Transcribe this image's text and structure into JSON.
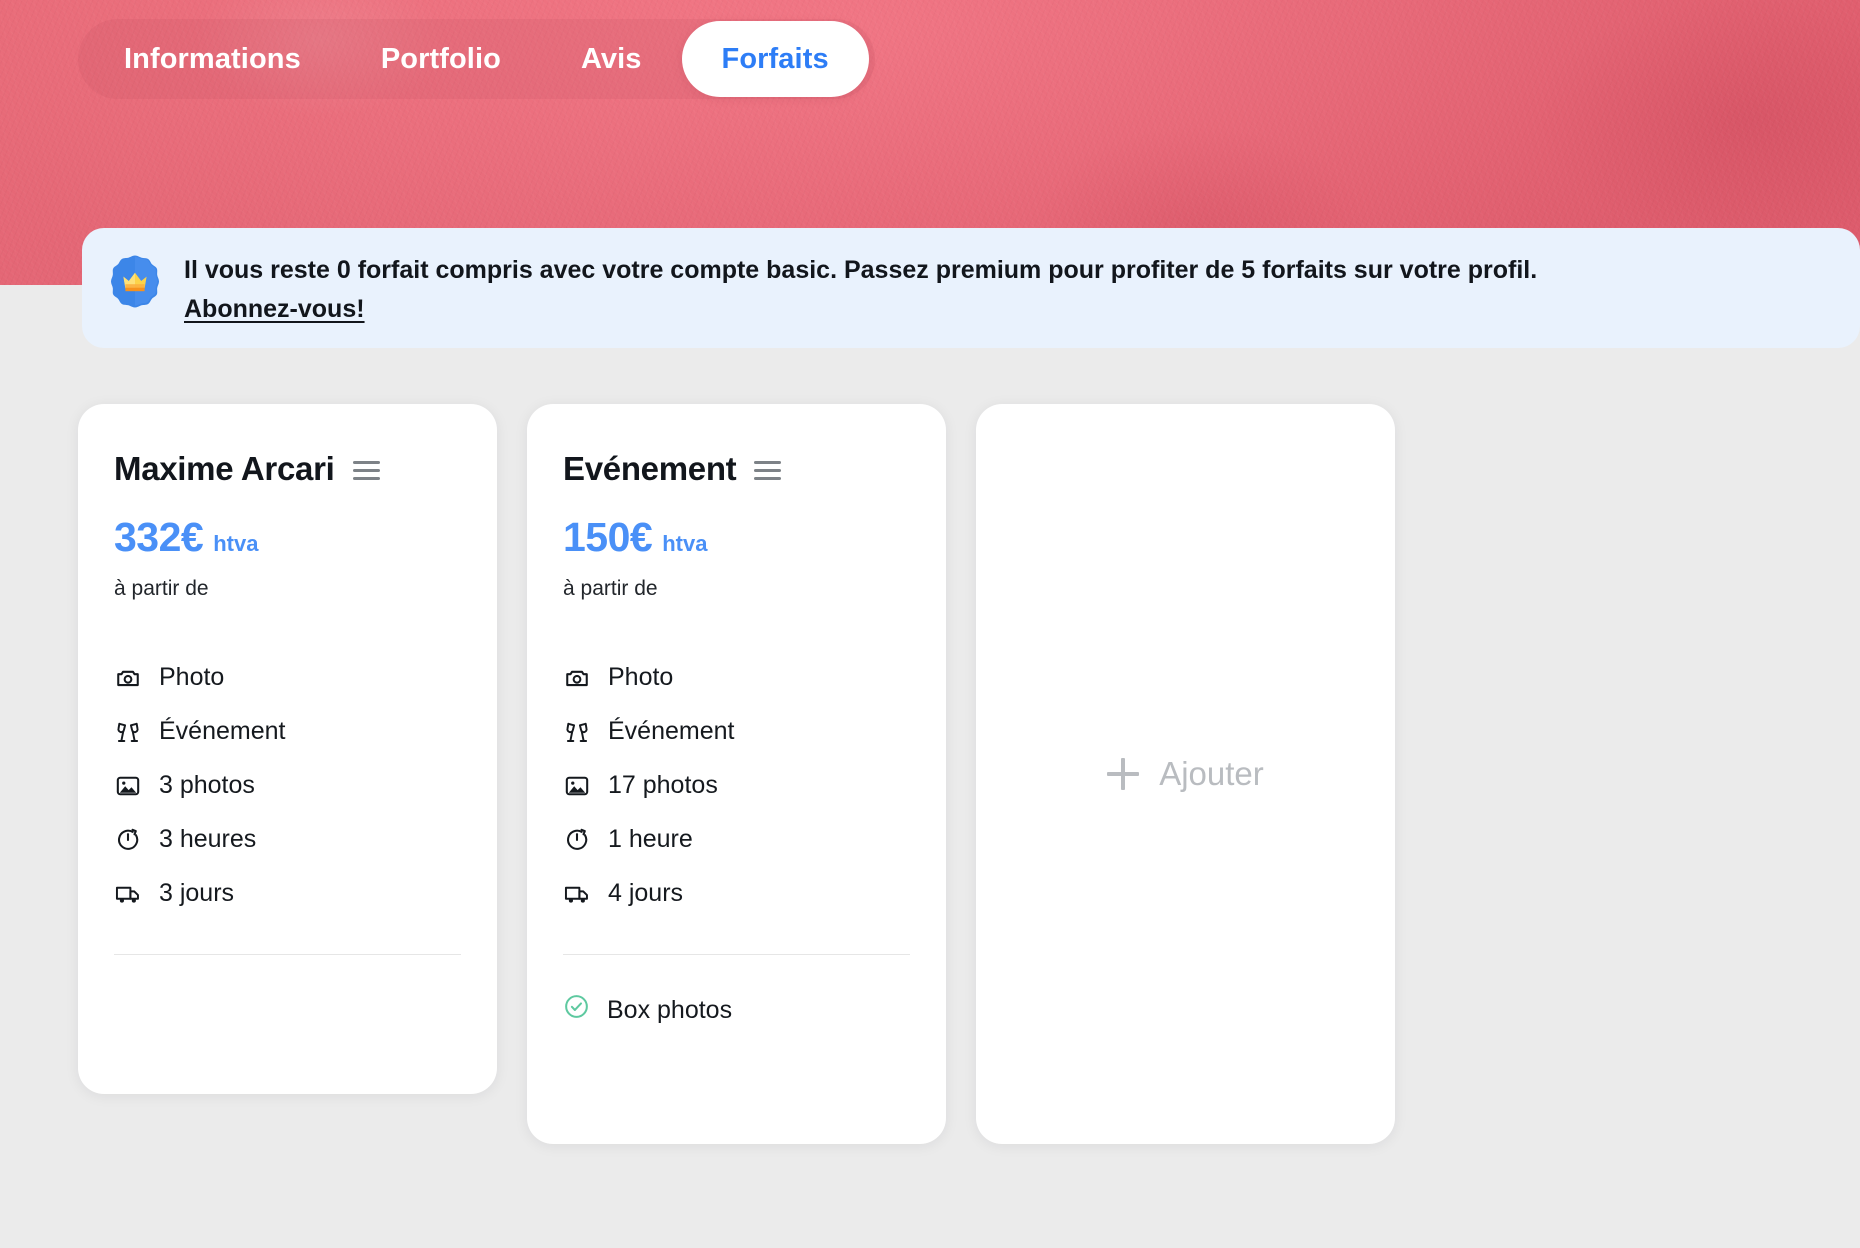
{
  "colors": {
    "hero": "#ef6a7a",
    "accent_blue": "#4a90f7",
    "tab_active_text": "#2d7df6",
    "banner_bg": "#e9f2fd",
    "page_bg": "#ebebeb",
    "check_green": "#5ec9a0",
    "muted": "#b9bcc0"
  },
  "tabs": [
    {
      "label": "Informations",
      "active": false
    },
    {
      "label": "Portfolio",
      "active": false
    },
    {
      "label": "Avis",
      "active": false
    },
    {
      "label": "Forfaits",
      "active": true
    }
  ],
  "banner": {
    "icon": "premium-crown-badge-icon",
    "message": "Il vous reste 0 forfait compris avec votre compte basic. Passez premium pour profiter de 5 forfaits sur votre profil.",
    "link_label": "Abonnez-vous!",
    "remaining_packages": 0,
    "premium_packages": 5,
    "account_type": "basic"
  },
  "packages": [
    {
      "title": "Maxime Arcari",
      "price": "332€",
      "price_suffix": "htva",
      "price_note": "à partir de",
      "menu_icon": "hamburger-menu-icon",
      "features": [
        {
          "icon": "camera-icon",
          "label": "Photo"
        },
        {
          "icon": "cheers-glasses-icon",
          "label": "Événement"
        },
        {
          "icon": "image-icon",
          "label": "3 photos"
        },
        {
          "icon": "stopwatch-icon",
          "label": "3 heures"
        },
        {
          "icon": "delivery-truck-icon",
          "label": "3 jours"
        }
      ],
      "extras": []
    },
    {
      "title": "Evénement",
      "price": "150€",
      "price_suffix": "htva",
      "price_note": "à partir de",
      "menu_icon": "hamburger-menu-icon",
      "features": [
        {
          "icon": "camera-icon",
          "label": "Photo"
        },
        {
          "icon": "cheers-glasses-icon",
          "label": "Événement"
        },
        {
          "icon": "image-icon",
          "label": "17 photos"
        },
        {
          "icon": "stopwatch-icon",
          "label": "1 heure"
        },
        {
          "icon": "delivery-truck-icon",
          "label": "4 jours"
        }
      ],
      "extras": [
        {
          "icon": "check-circle-icon",
          "label": "Box photos"
        }
      ]
    }
  ],
  "add_card": {
    "icon": "plus-icon",
    "label": "Ajouter"
  }
}
